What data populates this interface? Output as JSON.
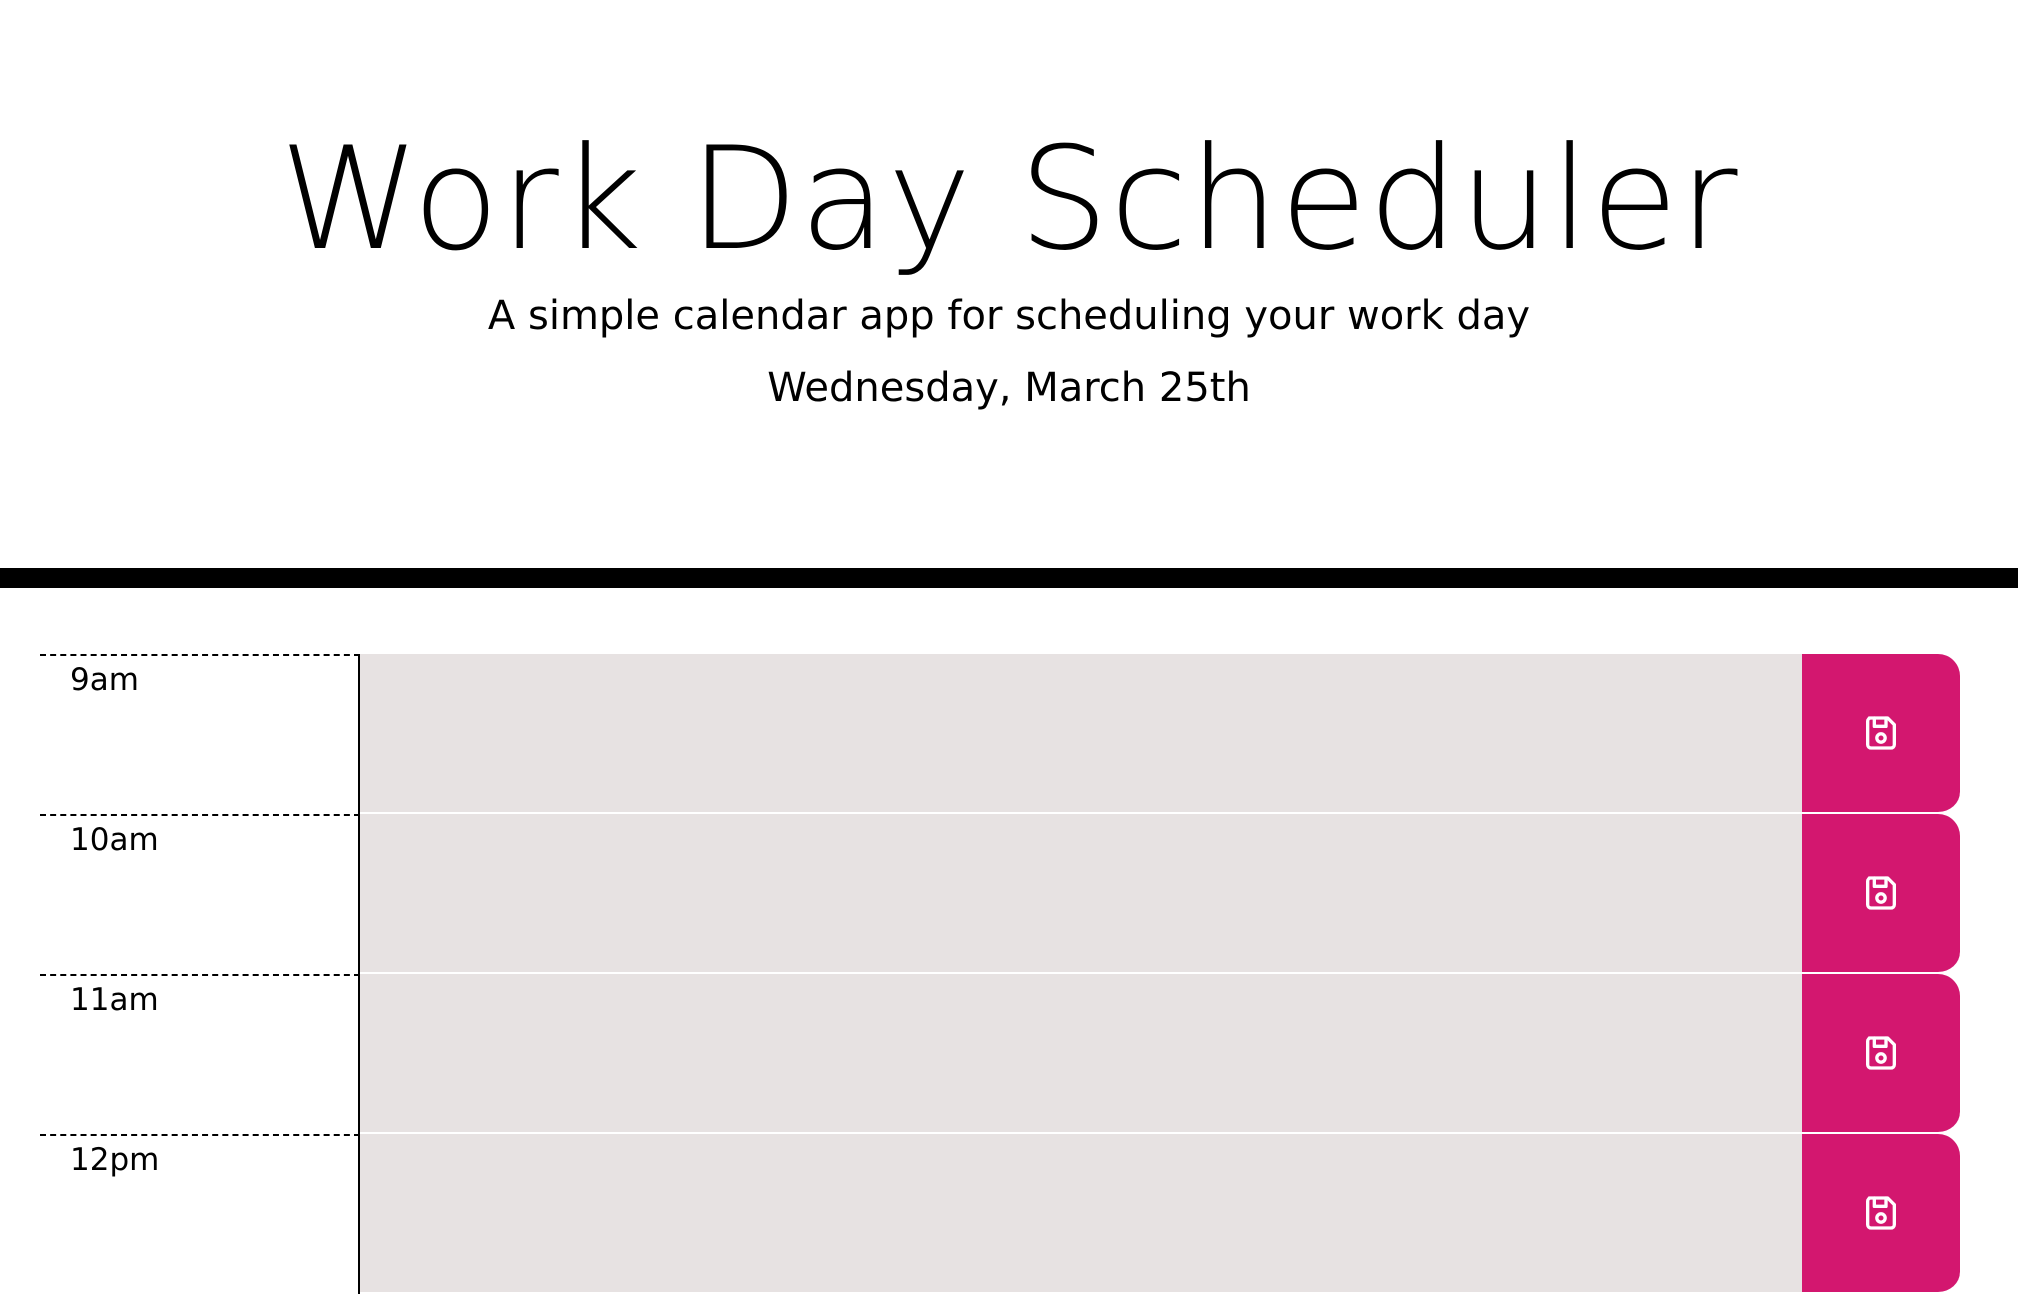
{
  "header": {
    "title": "Work Day Scheduler",
    "lead": "A simple calendar app for scheduling your work day",
    "current_day": "Wednesday, March 25th"
  },
  "time_blocks": [
    {
      "hour": "9am",
      "text": "",
      "save_icon": "save-icon"
    },
    {
      "hour": "10am",
      "text": "",
      "save_icon": "save-icon"
    },
    {
      "hour": "11am",
      "text": "",
      "save_icon": "save-icon"
    },
    {
      "hour": "12pm",
      "text": "",
      "save_icon": "save-icon"
    }
  ],
  "colors": {
    "accent": "#d3176f",
    "block_background": "#e7e2e2",
    "divider": "#000000"
  }
}
